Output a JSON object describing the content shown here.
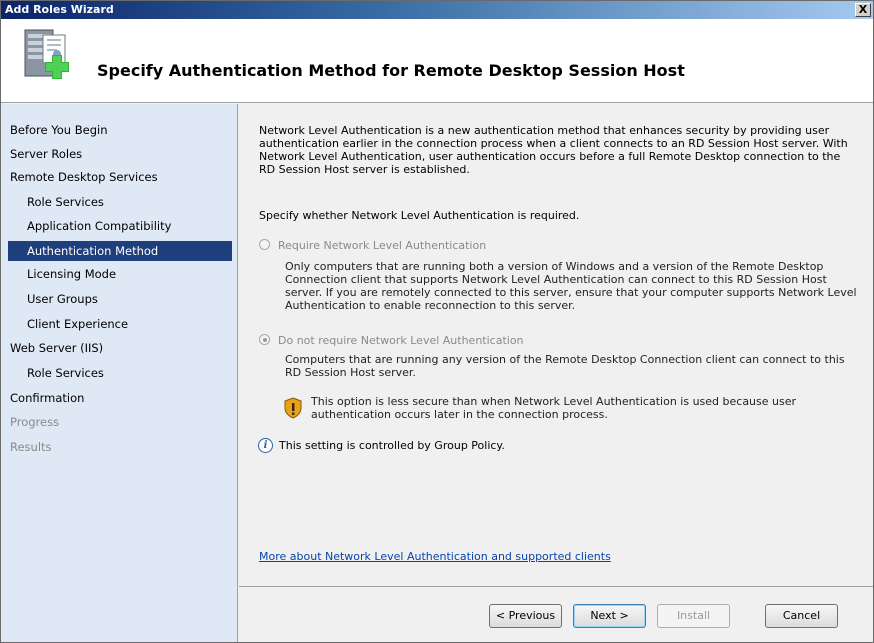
{
  "window": {
    "title": "Add Roles Wizard",
    "close_glyph": "X"
  },
  "header": {
    "title": "Specify Authentication Method for Remote Desktop Session Host",
    "icon": "server-roles-add-icon"
  },
  "nav": {
    "items": [
      {
        "label": "Before You Begin",
        "level": "top",
        "state": "normal"
      },
      {
        "label": "Server Roles",
        "level": "top",
        "state": "normal"
      },
      {
        "label": "Remote Desktop Services",
        "level": "top",
        "state": "normal"
      },
      {
        "label": "Role Services",
        "level": "sub",
        "state": "normal"
      },
      {
        "label": "Application Compatibility",
        "level": "sub",
        "state": "normal"
      },
      {
        "label": "Authentication Method",
        "level": "sub",
        "state": "selected"
      },
      {
        "label": "Licensing Mode",
        "level": "sub",
        "state": "normal"
      },
      {
        "label": "User Groups",
        "level": "sub",
        "state": "normal"
      },
      {
        "label": "Client Experience",
        "level": "sub",
        "state": "normal"
      },
      {
        "label": "Web Server (IIS)",
        "level": "top",
        "state": "normal"
      },
      {
        "label": "Role Services",
        "level": "sub",
        "state": "normal"
      },
      {
        "label": "Confirmation",
        "level": "top",
        "state": "normal"
      },
      {
        "label": "Progress",
        "level": "top",
        "state": "disabled"
      },
      {
        "label": "Results",
        "level": "top",
        "state": "disabled"
      }
    ]
  },
  "content": {
    "intro": "Network Level Authentication is a new authentication method that enhances security by providing user authentication earlier in the connection process when a client connects to an RD Session Host server. With Network Level Authentication, user authentication occurs before a full Remote Desktop connection to the RD Session Host server is established.",
    "specify": "Specify whether Network Level Authentication is required.",
    "option_require": {
      "label": "Require Network Level Authentication",
      "checked": false,
      "enabled": false,
      "description": "Only computers that are running both a version of Windows and a version of the Remote Desktop Connection client that supports Network Level Authentication can connect to this RD Session Host server. If you are remotely connected to this server, ensure that your computer supports Network Level Authentication to enable reconnection to this server."
    },
    "option_norequire": {
      "label": "Do not require Network Level Authentication",
      "checked": true,
      "enabled": false,
      "description": "Computers that are running any version of the Remote Desktop Connection client can connect to this RD Session Host server."
    },
    "warning": "This option is less secure than when Network Level Authentication is used because user authentication occurs later in the connection process.",
    "info": "This setting is controlled by Group Policy.",
    "info_glyph": "i",
    "link": "More about Network Level Authentication and supported clients"
  },
  "buttons": {
    "previous": "< Previous",
    "next": "Next >",
    "install": "Install",
    "cancel": "Cancel"
  },
  "colors": {
    "nav_background": "#dfe8f5",
    "nav_selected": "#1f3e7c",
    "link": "#0645ad",
    "disabled_text": "#8a8a8a"
  }
}
